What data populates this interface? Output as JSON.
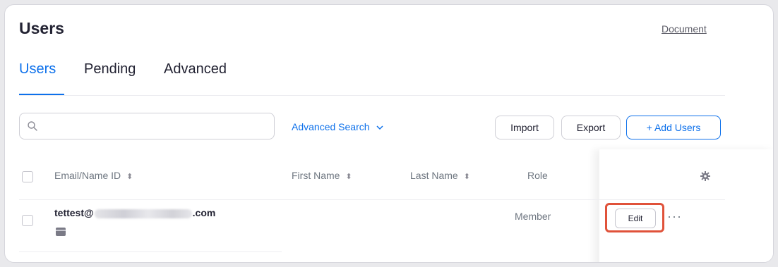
{
  "header": {
    "title": "Users",
    "doc_link": "Document"
  },
  "tabs": [
    {
      "label": "Users",
      "active": true
    },
    {
      "label": "Pending",
      "active": false
    },
    {
      "label": "Advanced",
      "active": false
    }
  ],
  "toolbar": {
    "search_placeholder": "",
    "search_value": "",
    "advanced_search_label": "Advanced Search",
    "import_label": "Import",
    "export_label": "Export",
    "add_users_label": "+ Add Users"
  },
  "table": {
    "columns": [
      "Email/Name ID",
      "First Name",
      "Last Name",
      "Role"
    ],
    "rows": [
      {
        "email_prefix": "tettest@",
        "email_suffix": ".com",
        "first_name": "",
        "last_name": "",
        "role": "Member",
        "edit_label": "Edit",
        "more_label": "···"
      }
    ]
  },
  "colors": {
    "accent": "#0e71eb",
    "highlight": "#e0523a",
    "text": "#232333",
    "muted": "#6e7680"
  },
  "icons": [
    "search-icon",
    "chevron-down-icon",
    "sort-icon",
    "gear-icon",
    "card-icon",
    "more-icon"
  ]
}
